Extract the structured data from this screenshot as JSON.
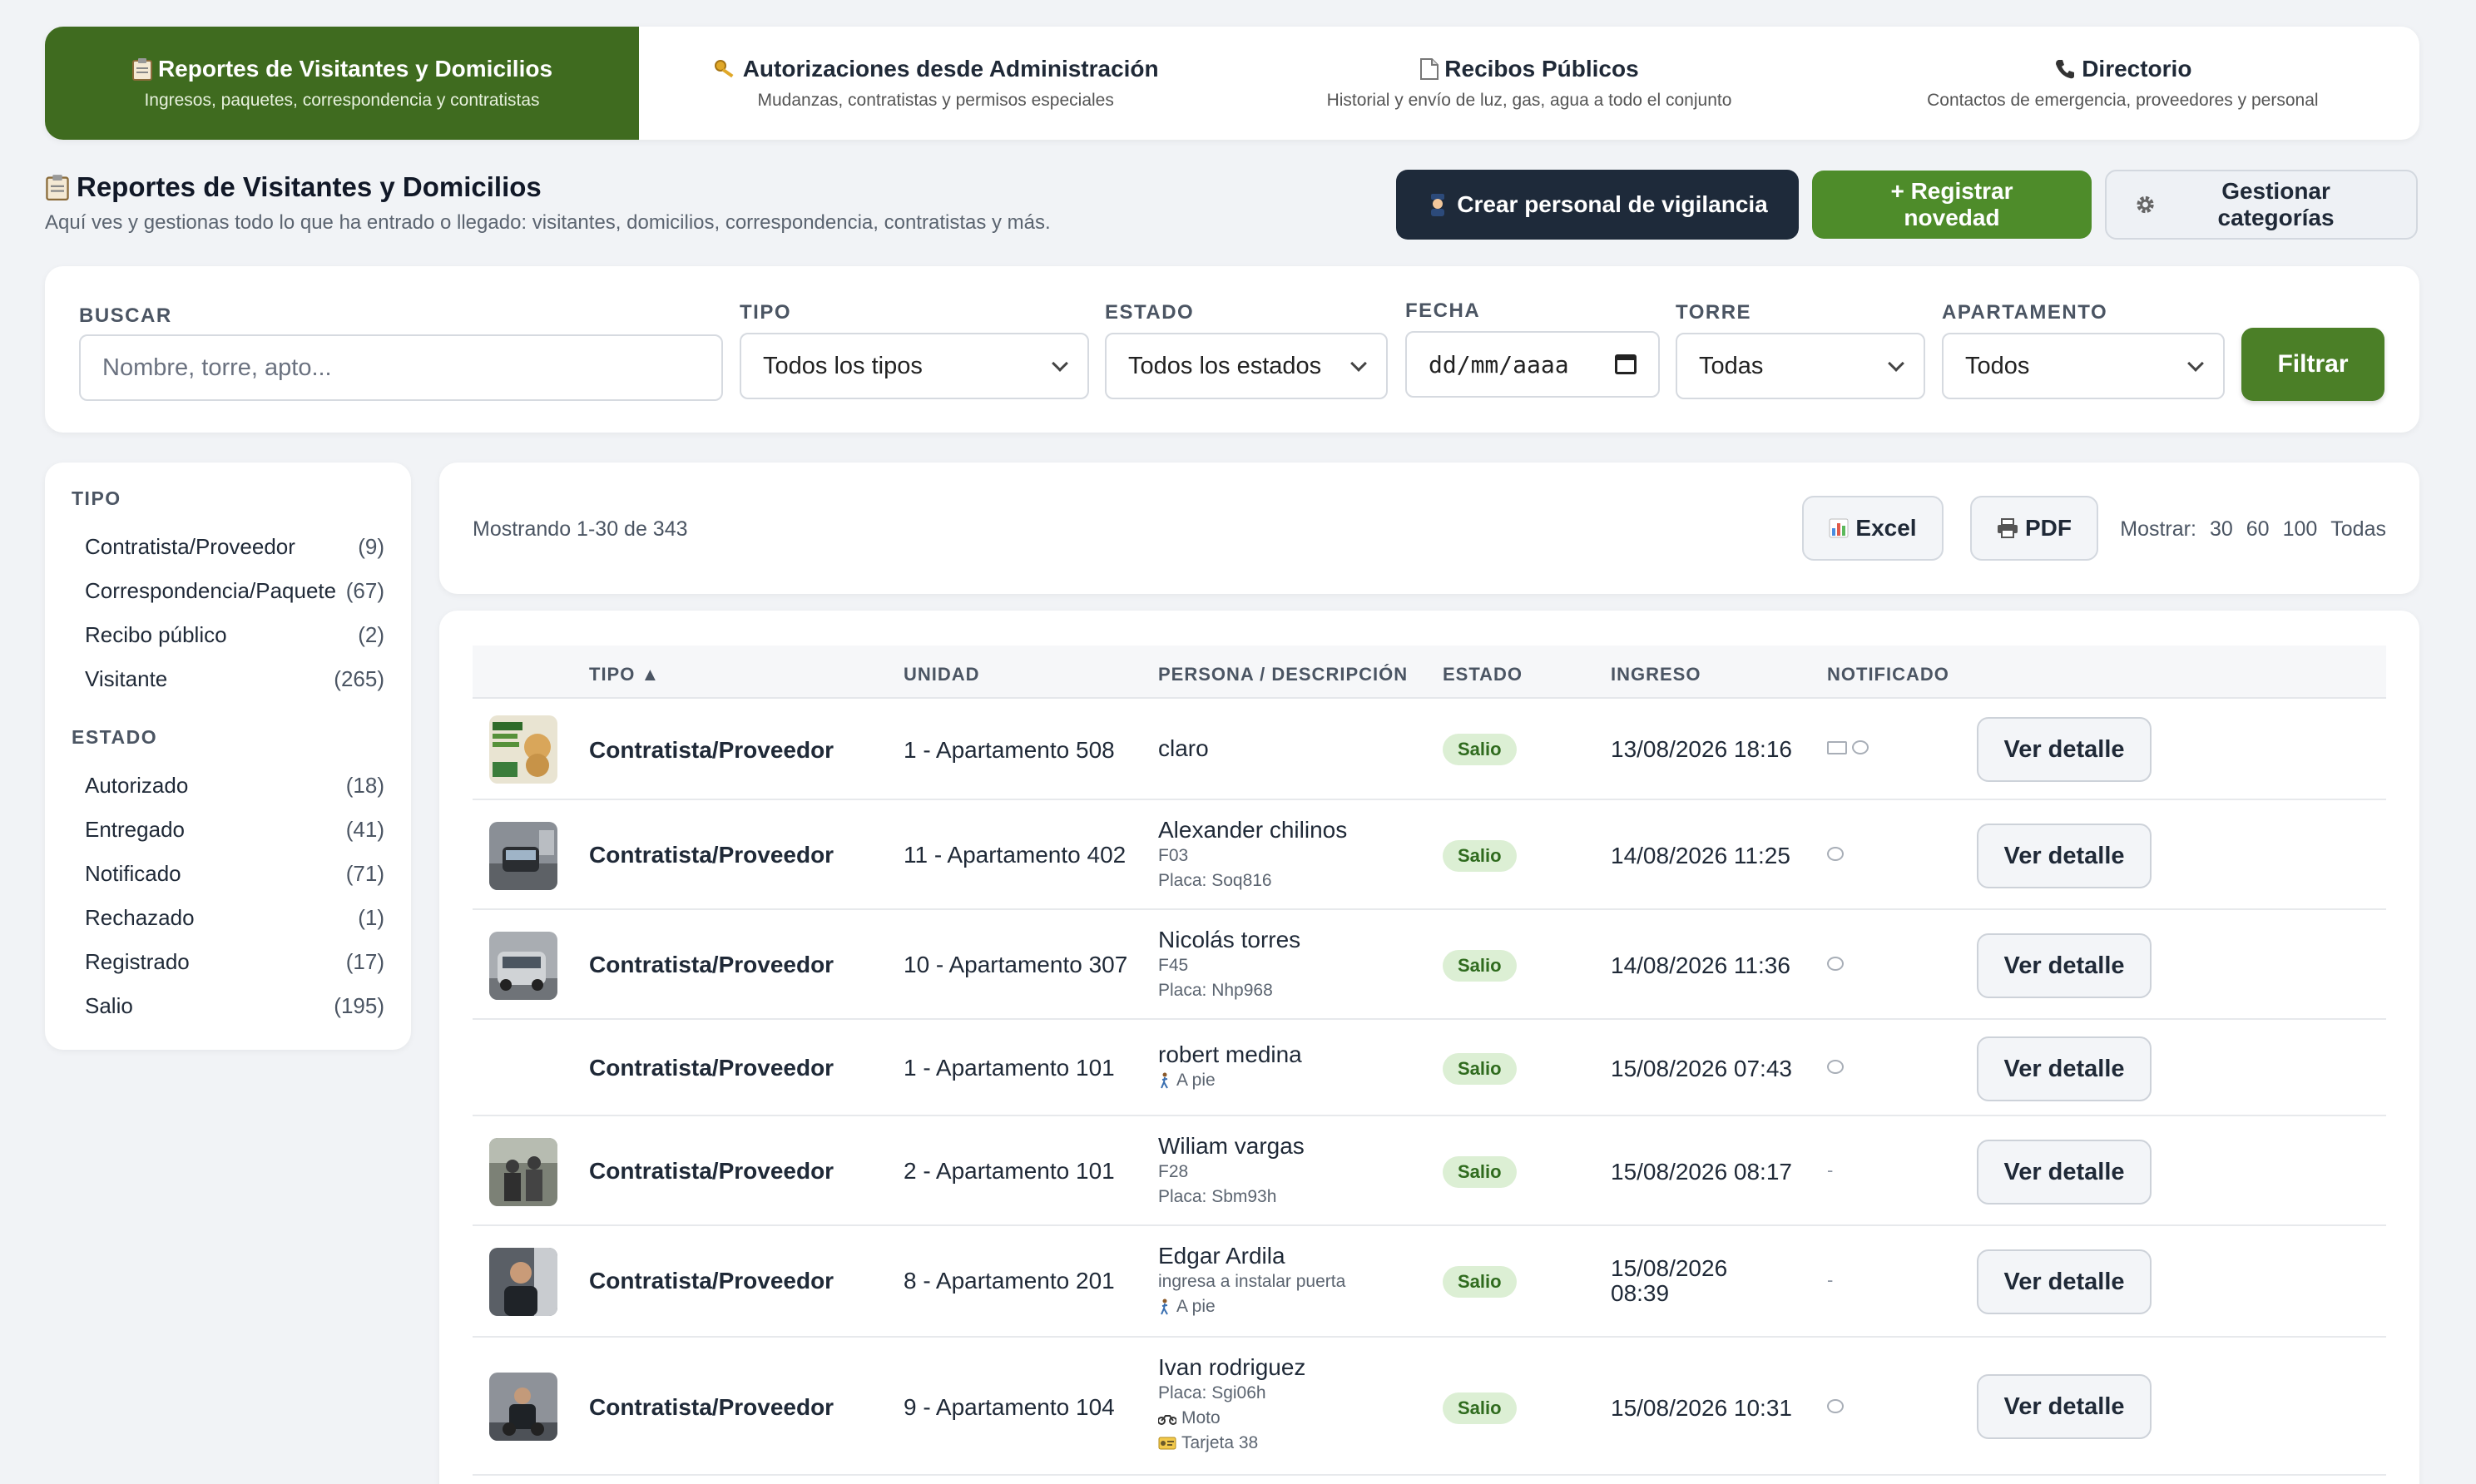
{
  "tabs": [
    {
      "icon": "clipboard-icon",
      "title": "Reportes de Visitantes y Domicilios",
      "subtitle": "Ingresos, paquetes, correspondencia y contratistas",
      "active": true
    },
    {
      "icon": "key-icon",
      "title": "Autorizaciones desde Administración",
      "subtitle": "Mudanzas, contratistas y permisos especiales",
      "active": false
    },
    {
      "icon": "document-icon",
      "title": "Recibos Públicos",
      "subtitle": "Historial y envío de luz, gas, agua a todo el conjunto",
      "active": false
    },
    {
      "icon": "phone-icon",
      "title": "Directorio",
      "subtitle": "Contactos de emergencia, proveedores y personal",
      "active": false
    }
  ],
  "header": {
    "title": "Reportes de Visitantes y Domicilios",
    "subtitle": "Aquí ves y gestionas todo lo que ha entrado o llegado: visitantes, domicilios, correspondencia, contratistas y más.",
    "btn_create_guard": "Crear personal de vigilancia",
    "btn_register": "+ Registrar novedad",
    "btn_categories": "Gestionar categorías"
  },
  "filters": {
    "search_label": "BUSCAR",
    "search_placeholder": "Nombre, torre, apto...",
    "tipo_label": "TIPO",
    "tipo_value": "Todos los tipos",
    "estado_label": "ESTADO",
    "estado_value": "Todos los estados",
    "fecha_label": "FECHA",
    "fecha_value": "dd/mm/aaaa",
    "torre_label": "TORRE",
    "torre_value": "Todas",
    "apto_label": "APARTAMENTO",
    "apto_value": "Todos",
    "filter_button": "Filtrar"
  },
  "sidebar": {
    "tipo_heading": "TIPO",
    "tipo_items": [
      {
        "label": "Contratista/Proveedor",
        "count": "(9)"
      },
      {
        "label": "Correspondencia/Paquete",
        "count": "(67)"
      },
      {
        "label": "Recibo público",
        "count": "(2)"
      },
      {
        "label": "Visitante",
        "count": "(265)"
      }
    ],
    "estado_heading": "ESTADO",
    "estado_items": [
      {
        "label": "Autorizado",
        "count": "(18)"
      },
      {
        "label": "Entregado",
        "count": "(41)"
      },
      {
        "label": "Notificado",
        "count": "(71)"
      },
      {
        "label": "Rechazado",
        "count": "(1)"
      },
      {
        "label": "Registrado",
        "count": "(17)"
      },
      {
        "label": "Salio",
        "count": "(195)"
      }
    ]
  },
  "toolbar": {
    "showing": "Mostrando 1-30 de 343",
    "excel": "Excel",
    "pdf": "PDF",
    "show_label": "Mostrar:",
    "show_options": [
      "30",
      "60",
      "100",
      "Todas"
    ]
  },
  "table": {
    "headers": {
      "tipo": "TIPO ▲",
      "unidad": "UNIDAD",
      "persona": "PERSONA / DESCRIPCIÓN",
      "estado": "ESTADO",
      "ingreso": "INGRESO",
      "notificado": "NOTIFICADO"
    },
    "detail_label": "Ver detalle",
    "rows": [
      {
        "tipo": "Contratista/Proveedor",
        "unidad": "1 - Apartamento 508",
        "persona": "claro",
        "sub1": "",
        "sub2": "",
        "sub3": "",
        "estado": "Salio",
        "ingreso": "13/08/2026 18:16",
        "notif": "icons"
      },
      {
        "tipo": "Contratista/Proveedor",
        "unidad": "11 - Apartamento 402",
        "persona": "Alexander chilinos",
        "sub1": "F03",
        "sub2": "Placa: Soq816",
        "sub3": "",
        "estado": "Salio",
        "ingreso": "14/08/2026 11:25",
        "notif": "chat"
      },
      {
        "tipo": "Contratista/Proveedor",
        "unidad": "10 - Apartamento 307",
        "persona": "Nicolás torres",
        "sub1": "F45",
        "sub2": "Placa: Nhp968",
        "sub3": "",
        "estado": "Salio",
        "ingreso": "14/08/2026 11:36",
        "notif": "chat"
      },
      {
        "tipo": "Contratista/Proveedor",
        "unidad": "1 - Apartamento 101",
        "persona": "robert medina",
        "sub1": "A pie",
        "sub2": "",
        "sub3": "",
        "estado": "Salio",
        "ingreso": "15/08/2026 07:43",
        "notif": "chat"
      },
      {
        "tipo": "Contratista/Proveedor",
        "unidad": "2 - Apartamento 101",
        "persona": "Wiliam vargas",
        "sub1": "F28",
        "sub2": "Placa: Sbm93h",
        "sub3": "",
        "estado": "Salio",
        "ingreso": "15/08/2026 08:17",
        "notif": "-"
      },
      {
        "tipo": "Contratista/Proveedor",
        "unidad": "8 - Apartamento 201",
        "persona": "Edgar Ardila",
        "sub1": "ingresa a instalar puerta",
        "sub2": "A pie",
        "sub3": "",
        "estado": "Salio",
        "ingreso_line1": "15/08/2026",
        "ingreso_line2": "08:39",
        "notif": "-"
      },
      {
        "tipo": "Contratista/Proveedor",
        "unidad": "9 - Apartamento 104",
        "persona": "Ivan rodriguez",
        "sub1": "Placa: Sgi06h",
        "sub2": "Moto",
        "sub3": "Tarjeta 38",
        "estado": "Salio",
        "ingreso": "15/08/2026 10:31",
        "notif": "chat"
      }
    ]
  }
}
